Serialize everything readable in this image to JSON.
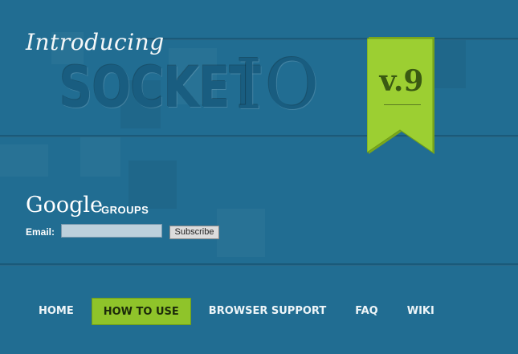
{
  "header": {
    "intro_text": "Introducing",
    "title_socket": "SOCKET",
    "title_io": "IO",
    "version": "v.9",
    "ribbon_color": "#9ccf32",
    "background_color": "#216d92"
  },
  "groups": {
    "logo_text": "Google",
    "label": "GROUPS",
    "email_label": "Email:",
    "email_value": "",
    "subscribe_label": "Subscribe"
  },
  "nav": {
    "items": [
      {
        "label": "HOME"
      },
      {
        "label": "HOW TO USE"
      },
      {
        "label": "BROWSER SUPPORT"
      },
      {
        "label": "FAQ"
      },
      {
        "label": "WIKI"
      }
    ],
    "active_color": "#8fc42a"
  }
}
